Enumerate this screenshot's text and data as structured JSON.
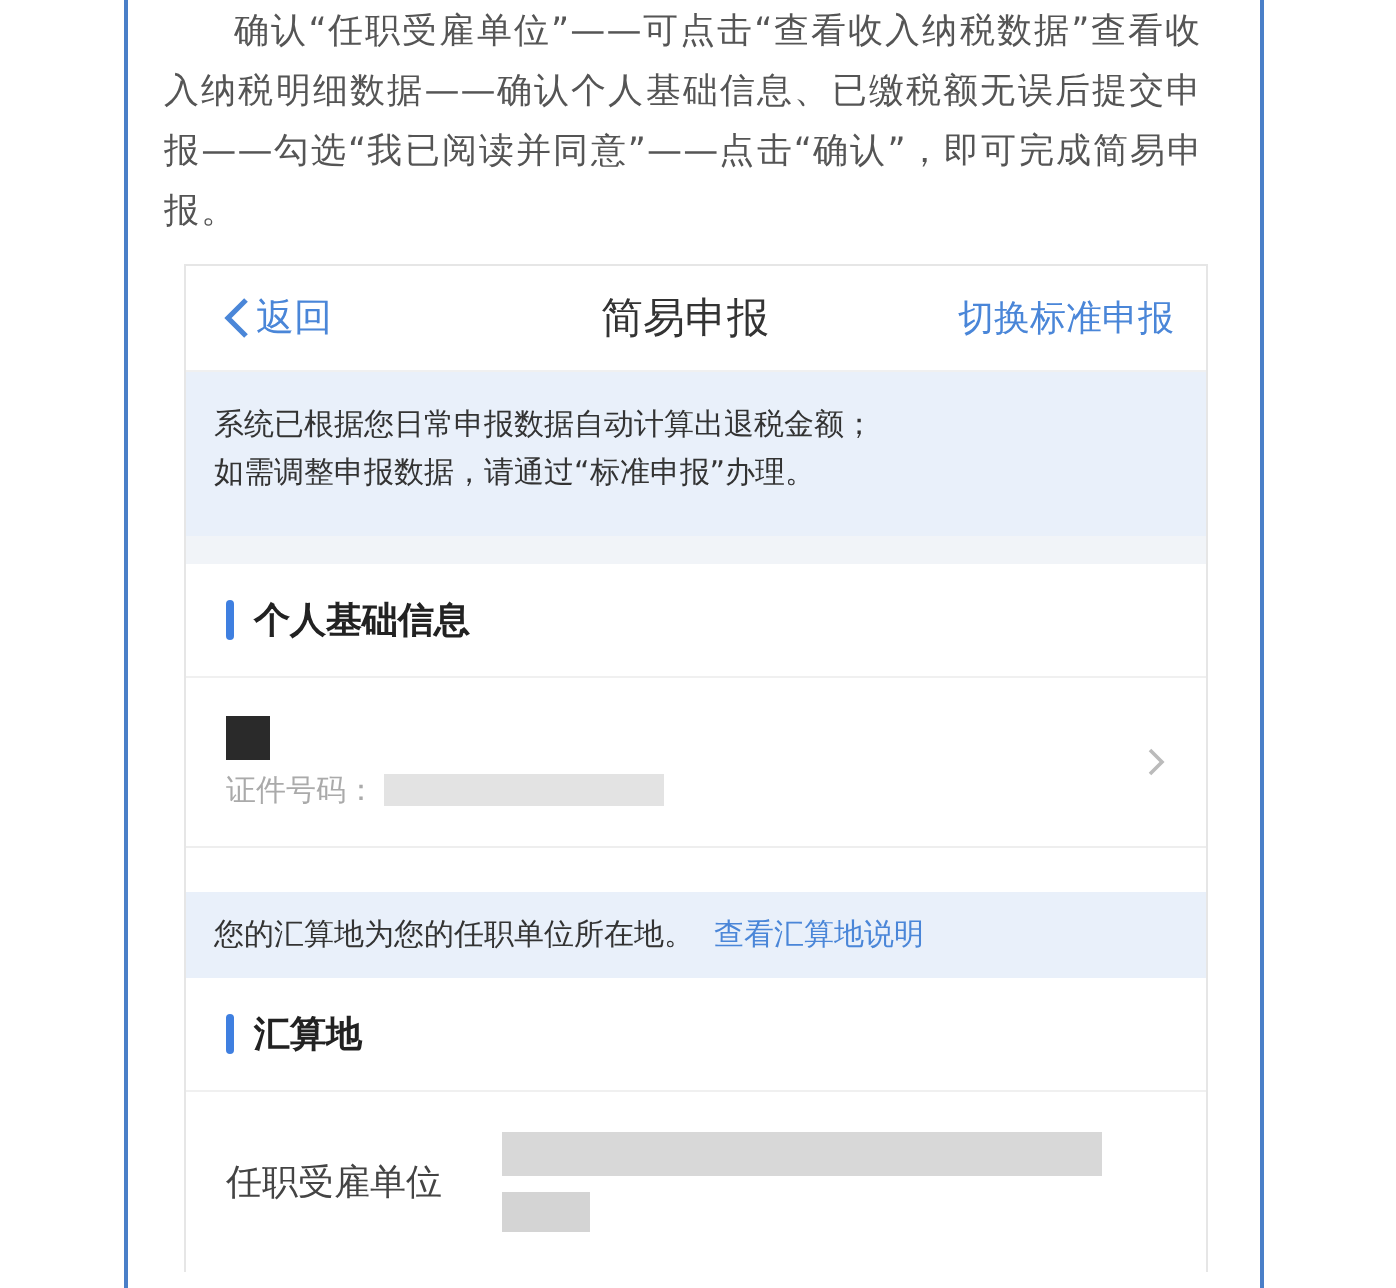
{
  "article": {
    "paragraph": "确认“任职受雇单位”——可点击“查看收入纳税数据”查看收入纳税明细数据——确认个人基础信息、已缴税额无误后提交申报——勾选“我已阅读并同意”——点击“确认”，即可完成简易申报。"
  },
  "screen": {
    "nav": {
      "back": "返回",
      "title": "简易申报",
      "action": "切换标准申报"
    },
    "blocks": [
      {
        "kind": "notice",
        "lines": [
          "系统已根据您日常申报数据自动计算出退税金额；",
          "如需调整申报数据，请通过“标准申报”办理。"
        ]
      },
      {
        "kind": "section",
        "title": "个人基础信息",
        "rows": [
          {
            "kind": "identity",
            "label": "证件号码："
          }
        ]
      },
      {
        "kind": "notice",
        "text": "您的汇算地为您的任职单位所在地。",
        "link": "查看汇算地说明"
      },
      {
        "kind": "section",
        "title": "汇算地",
        "rows": [
          {
            "kind": "field",
            "label": "任职受雇单位"
          }
        ]
      }
    ]
  }
}
